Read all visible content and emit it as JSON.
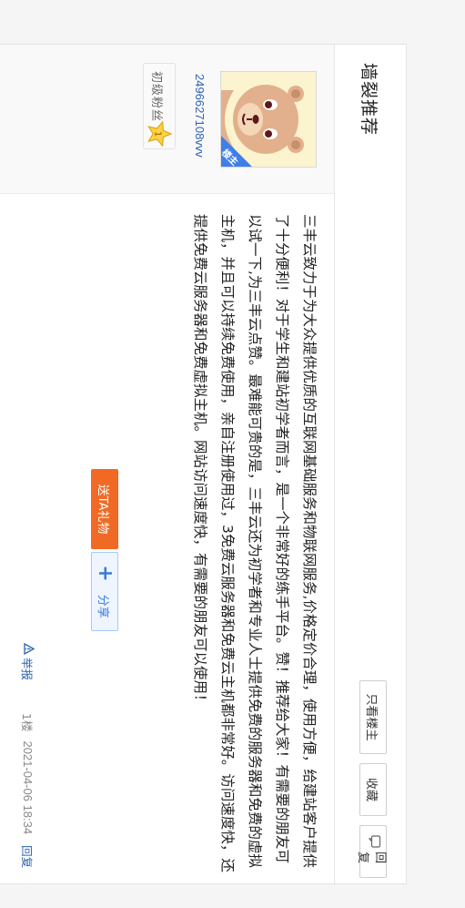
{
  "header": {
    "title": "墙裂推荐",
    "actions": {
      "only_op": "只看楼主",
      "favorite": "收藏",
      "reply": "回复"
    }
  },
  "author": {
    "username": "2496627108vvv",
    "owner_badge": "楼主",
    "fan_level_label": "初级粉丝",
    "fan_level_number": "1"
  },
  "post": {
    "text": "三丰云致力于为大众提供优质的互联网基础服务和物联网服务,价格定价合理，使用方便，给建站客户提供了十分便利！对于学生和建站初学者而言，是一个非常好的练手平台。赞！推荐给大家！有需要的朋友可以试一下,为三丰云点赞。最难能可贵的是，三丰云还为初学者和专业人士提供免费的服务器和免费的虚拟主机，并且可以持续免费使用，亲自注册使用过，3免费云服务器和免费云主机都非常好。访问速度快，还提供免费云服务器和免费虚拟主机。网站访问速度快，有需要的朋友可以使用！",
    "gift_label": "送TA礼物",
    "share_label": "分享",
    "report_label": "举报",
    "floor": "1楼",
    "time": "2021-04-06 18:34",
    "reply_label": "回复"
  },
  "colors": {
    "accent": "#3f7fe8",
    "link": "#2d64b3",
    "gift": "#f06a25"
  }
}
